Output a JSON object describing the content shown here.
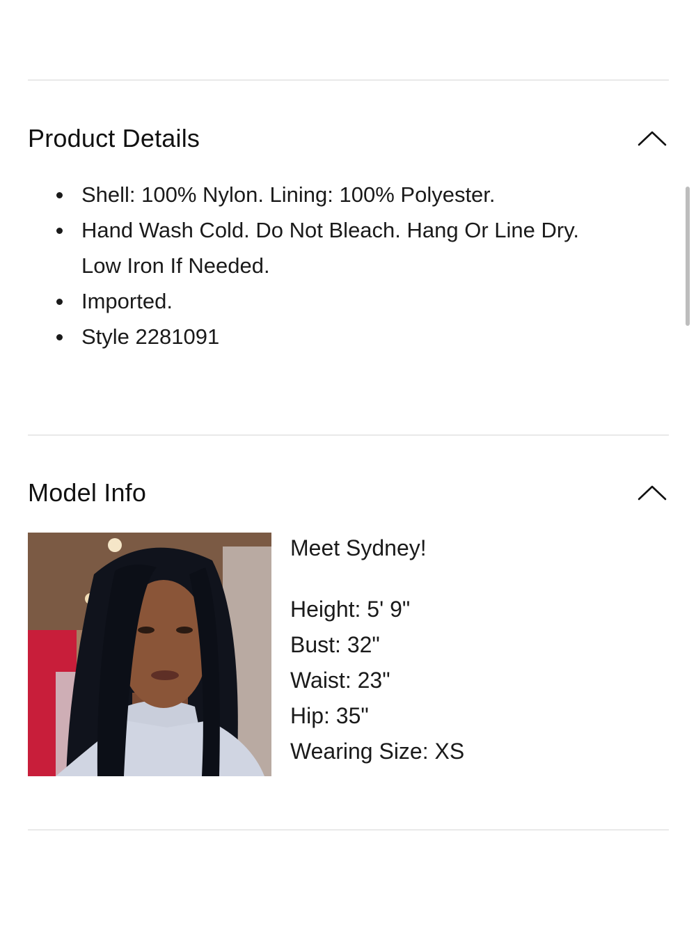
{
  "product_details": {
    "title": "Product Details",
    "toggle_icon": "chevron-up-icon",
    "items": [
      {
        "line1": "Shell: 100% Nylon. Lining: 100% Polyester.",
        "line2": ""
      },
      {
        "line1": "Hand Wash Cold. Do Not Bleach. Hang Or Line Dry.",
        "line2": "Low Iron If Needed."
      },
      {
        "line1": "Imported.",
        "line2": ""
      },
      {
        "line1": "Style 2281091",
        "line2": ""
      }
    ]
  },
  "model_info": {
    "title": "Model Info",
    "toggle_icon": "chevron-up-icon",
    "photo": "model-photo",
    "greeting": "Meet Sydney!",
    "stats": {
      "height": "Height: 5' 9\"",
      "bust": "Bust: 32\"",
      "waist": "Waist: 23\"",
      "hip": "Hip: 35\"",
      "size": "Wearing Size: XS"
    }
  }
}
